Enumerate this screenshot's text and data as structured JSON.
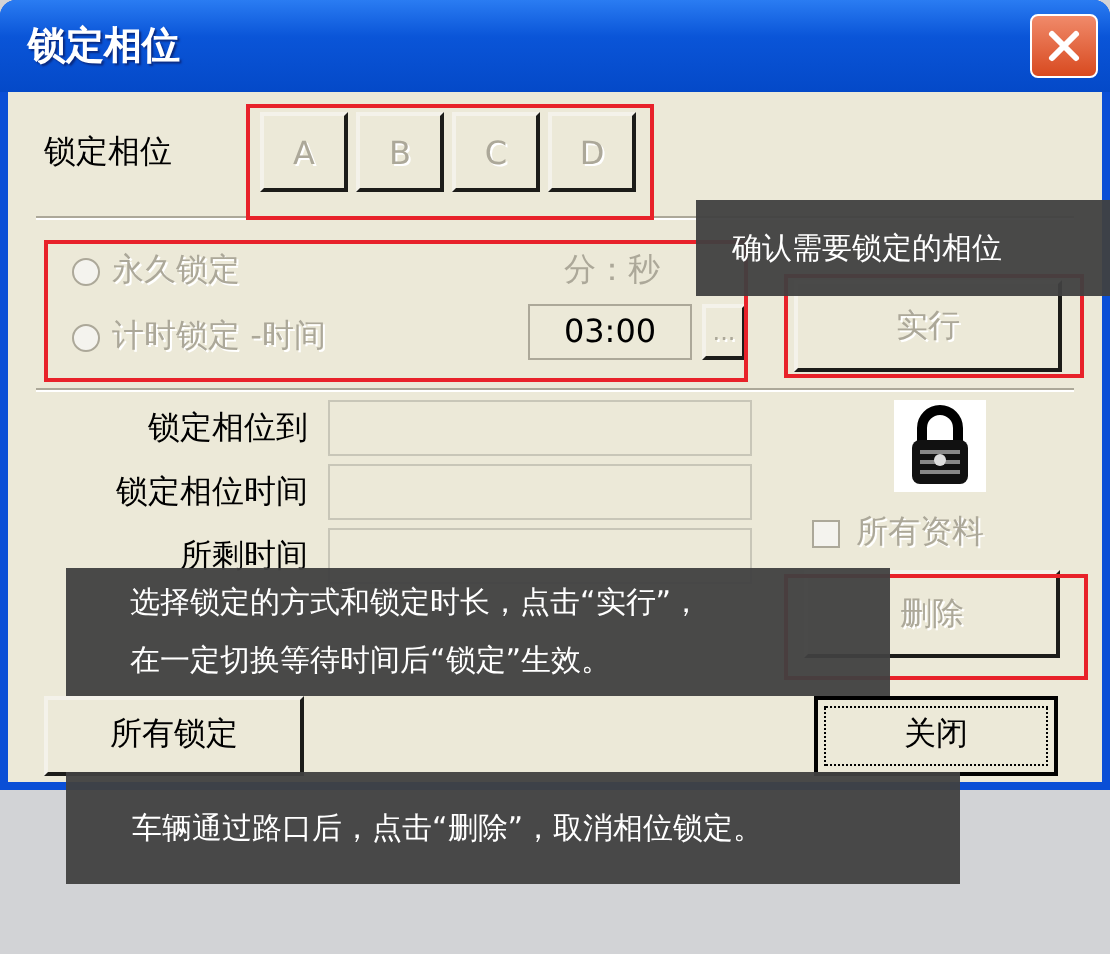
{
  "window": {
    "title": "锁定相位"
  },
  "phase_row": {
    "label": "锁定相位",
    "buttons": [
      {
        "label": "A",
        "disabled": true
      },
      {
        "label": "B",
        "disabled": true
      },
      {
        "label": "C",
        "disabled": true
      },
      {
        "label": "D",
        "disabled": true
      }
    ]
  },
  "mode": {
    "options": [
      {
        "label": "永久锁定",
        "selected": false,
        "disabled": true
      },
      {
        "label": "计时锁定 -时间",
        "selected": false,
        "disabled": true
      }
    ],
    "time_unit_label": "分：秒",
    "time_value": "03:00",
    "browse_button": "...",
    "execute_button": {
      "label": "实行",
      "disabled": true
    }
  },
  "info_fields": [
    {
      "label": "锁定相位到"
    },
    {
      "label": "锁定相位时间"
    },
    {
      "label": "所剩时间"
    }
  ],
  "all_data_checkbox": {
    "label": "所有资料",
    "checked": false,
    "disabled": true
  },
  "delete_button": {
    "label": "删除",
    "disabled": true
  },
  "bottom_buttons": [
    {
      "label": "所有锁定",
      "default": false
    },
    {
      "label": "关闭",
      "default": true
    }
  ],
  "annotations": [
    {
      "lines": [
        "确认需要锁定的相位"
      ]
    },
    {
      "lines": [
        "选择锁定的方式和锁定时长，点击“实行”，",
        "在一定切换等待时间后“锁定”生效。"
      ]
    },
    {
      "lines": [
        "车辆通过路口后，点击“删除”，取消相位锁定。"
      ]
    }
  ]
}
